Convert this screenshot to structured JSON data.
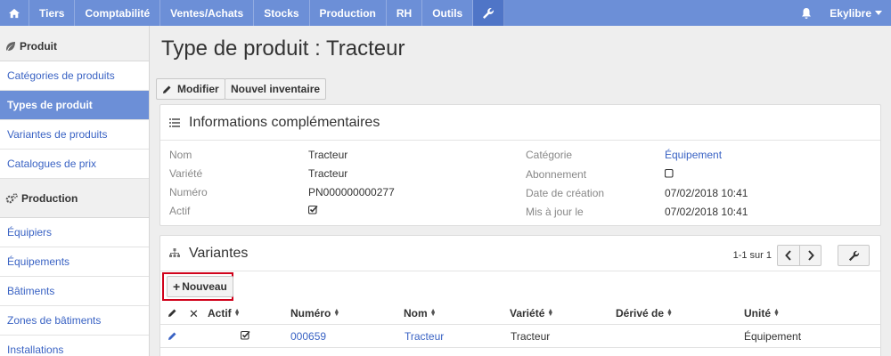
{
  "nav": {
    "items": [
      "Tiers",
      "Comptabilité",
      "Ventes/Achats",
      "Stocks",
      "Production",
      "RH",
      "Outils"
    ],
    "user": "Ekylibre",
    "accent": "#6c8fd7"
  },
  "sidebar": {
    "section1": "Produit",
    "items1": [
      "Catégories de produits",
      "Types de produit",
      "Variantes de produits",
      "Catalogues de prix"
    ],
    "section2": "Production",
    "items2": [
      "Équipiers",
      "Équipements",
      "Bâtiments",
      "Zones de bâtiments",
      "Installations"
    ]
  },
  "page": {
    "title": "Type de produit : Tracteur",
    "btn_edit": "Modifier",
    "btn_inventory": "Nouvel inventaire"
  },
  "info": {
    "title": "Informations complémentaires",
    "left": [
      {
        "label": "Nom",
        "value": "Tracteur"
      },
      {
        "label": "Variété",
        "value": "Tracteur"
      },
      {
        "label": "Numéro",
        "value": "PN000000000277"
      },
      {
        "label": "Actif",
        "value": "checked"
      }
    ],
    "right": [
      {
        "label": "Catégorie",
        "value": "Équipement"
      },
      {
        "label": "Abonnement",
        "value": "unchecked"
      },
      {
        "label": "Date de création",
        "value": "07/02/2018 10:41"
      },
      {
        "label": "Mis à jour le",
        "value": "07/02/2018 10:41"
      }
    ]
  },
  "variants": {
    "title": "Variantes",
    "pagination": "1-1 sur 1",
    "new_button": "Nouveau",
    "columns": [
      "Actif",
      "Numéro",
      "Nom",
      "Variété",
      "Dérivé de",
      "Unité"
    ],
    "rows": [
      {
        "actif": true,
        "numero": "000659",
        "nom": "Tracteur",
        "variete": "Tracteur",
        "derive": "",
        "unite": "Équipement"
      }
    ]
  }
}
